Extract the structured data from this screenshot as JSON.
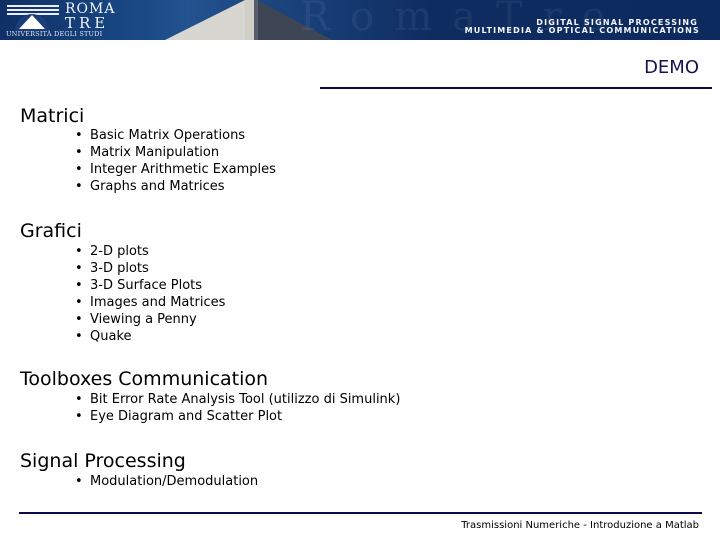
{
  "banner": {
    "logo_line1": "ROMA",
    "logo_line2": "TRE",
    "logo_subtitle": "UNIVERSITÀ DEGLI STUDI",
    "tagline_line1": "DIGITAL SIGNAL PROCESSING",
    "tagline_line2": "MULTIMEDIA & OPTICAL  COMMUNICATIONS"
  },
  "slide": {
    "title": "DEMO",
    "bullet_glyph": "•",
    "sections": [
      {
        "title": "Matrici",
        "items": [
          "Basic Matrix Operations",
          "Matrix Manipulation",
          "Integer Arithmetic Examples",
          "Graphs and Matrices"
        ]
      },
      {
        "title": "Grafici",
        "items": [
          "2-D plots",
          "3-D plots",
          "3-D Surface Plots",
          "Images and Matrices",
          "Viewing a Penny",
          "Quake"
        ]
      },
      {
        "title": "Toolboxes Communication",
        "items": [
          "Bit Error Rate Analysis Tool (utilizzo di Simulink)",
          "Eye Diagram and Scatter Plot"
        ]
      },
      {
        "title": "Signal Processing",
        "items": [
          "Modulation/Demodulation"
        ]
      }
    ]
  },
  "footer": {
    "text": "Trasmissioni Numeriche - Introduzione a Matlab"
  },
  "colors": {
    "banner_bg": "#0f2c60",
    "title": "#141450",
    "rule": "#0c0a4a"
  }
}
